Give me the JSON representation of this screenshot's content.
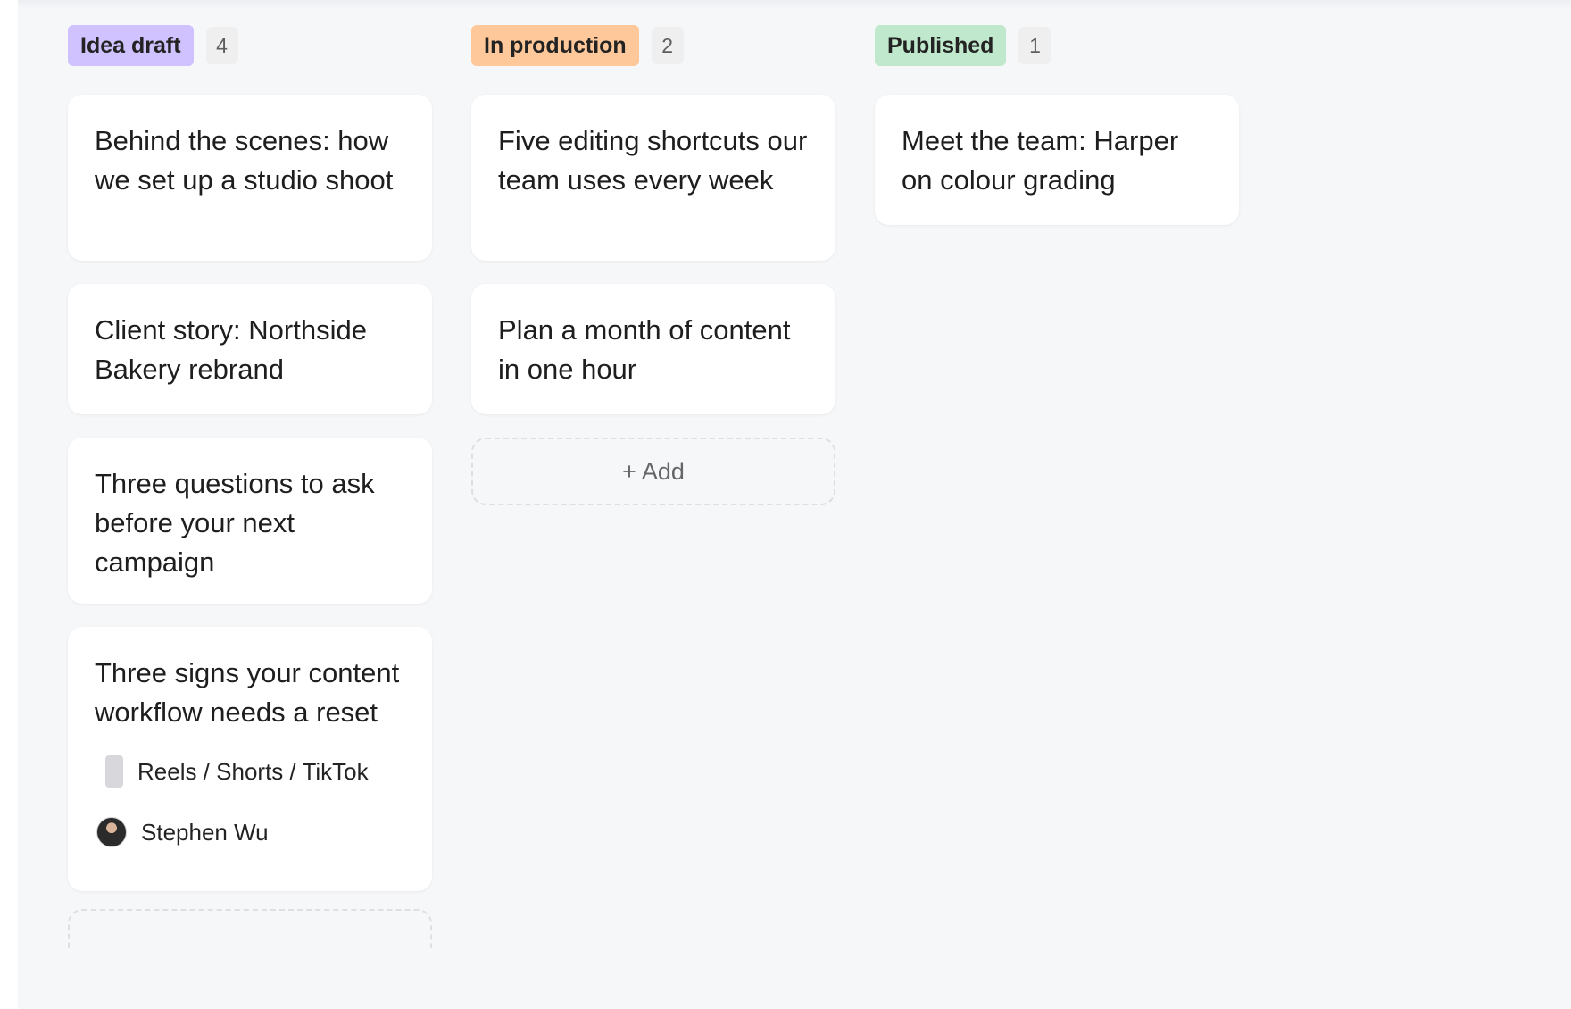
{
  "board": {
    "columns": [
      {
        "title": "Idea draft",
        "count": "4",
        "color": "#cfc2ff",
        "cards": [
          {
            "title": "Behind the scenes: how we set up a studio shoot"
          },
          {
            "title": "Client story: Northside Bakery rebrand"
          },
          {
            "title": "Three questions to ask before your next campaign"
          },
          {
            "title": "Three signs your content workflow needs a reset",
            "format": "Reels / Shorts / TikTok",
            "assignee": "Stephen Wu"
          }
        ]
      },
      {
        "title": "In production",
        "count": "2",
        "color": "#ffc89a",
        "cards": [
          {
            "title": "Five editing shortcuts our team uses every week"
          },
          {
            "title": "Plan a month of content in one hour"
          }
        ],
        "add_label": "+ Add"
      },
      {
        "title": "Published",
        "count": "1",
        "color": "#bfe8cc",
        "cards": [
          {
            "title": "Meet the team: Harper on colour grading"
          }
        ]
      }
    ]
  }
}
